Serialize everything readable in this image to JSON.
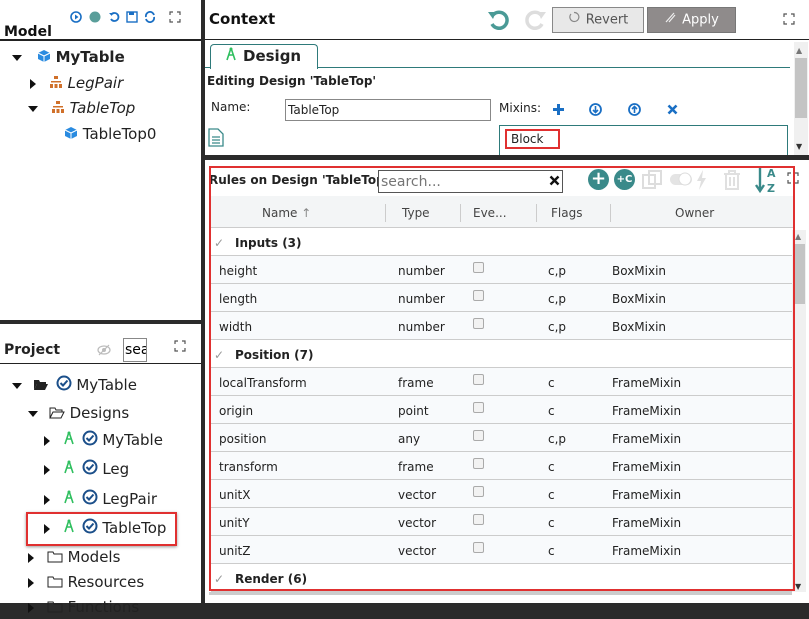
{
  "model_panel": {
    "title": "Model",
    "toolbar_icons": [
      "play-icon",
      "status-dot-icon",
      "undo-icon",
      "save-icon",
      "refresh-icon",
      "maximize-icon"
    ],
    "tree": [
      {
        "label": "MyTable",
        "icon": "cube-icon",
        "expanded": true,
        "level": 0
      },
      {
        "label": "LegPair",
        "icon": "hierarchy-icon",
        "expanded": false,
        "level": 1
      },
      {
        "label": "TableTop",
        "icon": "hierarchy-icon",
        "expanded": true,
        "level": 1
      },
      {
        "label": "TableTop0",
        "icon": "cube-icon",
        "level": 2
      }
    ]
  },
  "project_panel": {
    "title": "Project",
    "search_value": "sea",
    "tree": [
      {
        "label": "MyTable",
        "icon": "folder-open-icon",
        "expanded": true,
        "level": 0
      },
      {
        "label": "Designs",
        "icon": "folder-open-icon",
        "expanded": true,
        "level": 1
      },
      {
        "label": "MyTable",
        "icon": "design-icon",
        "level": 2
      },
      {
        "label": "Leg",
        "icon": "design-icon",
        "level": 2
      },
      {
        "label": "LegPair",
        "icon": "design-icon",
        "level": 2
      },
      {
        "label": "TableTop",
        "icon": "design-icon",
        "level": 2,
        "highlighted": true
      },
      {
        "label": "Models",
        "icon": "folder-icon",
        "level": 1
      },
      {
        "label": "Resources",
        "icon": "folder-icon",
        "level": 1
      },
      {
        "label": "Functions",
        "icon": "folder-icon",
        "level": 1
      }
    ]
  },
  "context_panel": {
    "title": "Context",
    "revert_label": "Revert",
    "apply_label": "Apply",
    "tab_label": "Design",
    "editing_title": "Editing Design 'TableTop'",
    "name_label": "Name:",
    "name_value": "TableTop",
    "mixins_label": "Mixins:",
    "mixins": [
      "Block"
    ]
  },
  "rules_panel": {
    "title": "Rules on Design 'TableTop'",
    "search_placeholder": "search...",
    "columns": [
      "Name",
      "Type",
      "Eve...",
      "Flags",
      "Owner"
    ],
    "sort_indicator": "↑",
    "groups": [
      {
        "label": "Inputs (3)",
        "rows": [
          {
            "name": "height",
            "type": "number",
            "flags": "c,p",
            "owner": "BoxMixin"
          },
          {
            "name": "length",
            "type": "number",
            "flags": "c,p",
            "owner": "BoxMixin"
          },
          {
            "name": "width",
            "type": "number",
            "flags": "c,p",
            "owner": "BoxMixin"
          }
        ]
      },
      {
        "label": "Position (7)",
        "rows": [
          {
            "name": "localTransform",
            "type": "frame",
            "flags": "c",
            "owner": "FrameMixin"
          },
          {
            "name": "origin",
            "type": "point",
            "flags": "c",
            "owner": "FrameMixin"
          },
          {
            "name": "position",
            "type": "any",
            "flags": "c,p",
            "owner": "FrameMixin"
          },
          {
            "name": "transform",
            "type": "frame",
            "flags": "c",
            "owner": "FrameMixin"
          },
          {
            "name": "unitX",
            "type": "vector",
            "flags": "c",
            "owner": "FrameMixin"
          },
          {
            "name": "unitY",
            "type": "vector",
            "flags": "c",
            "owner": "FrameMixin"
          },
          {
            "name": "unitZ",
            "type": "vector",
            "flags": "c",
            "owner": "FrameMixin"
          }
        ]
      },
      {
        "label": "Render (6)",
        "rows": []
      }
    ]
  },
  "colors": {
    "accent_teal": "#3a8a8a",
    "highlight_red": "#e03030",
    "design_green": "#2fbf5f",
    "blue_icon": "#1a6fc4"
  }
}
